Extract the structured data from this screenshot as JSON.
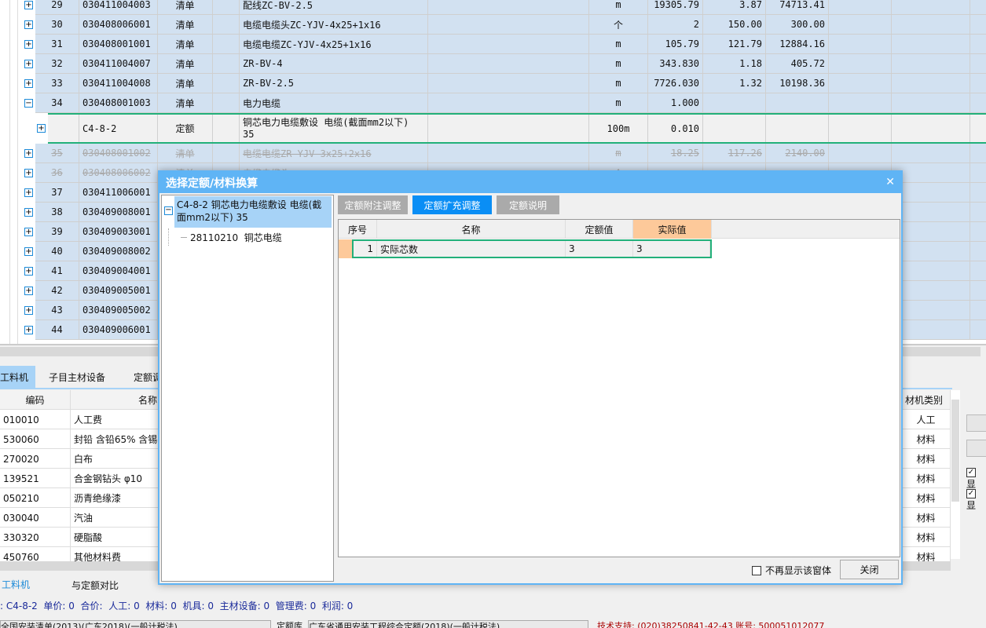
{
  "grid": {
    "rows": [
      {
        "seq": "29",
        "code": "030411004003",
        "type": "清单",
        "name": "配线ZC-BV-2.5",
        "unit": "m",
        "qty": "19305.79",
        "price": "3.87",
        "total": "74713.41",
        "exp": "+"
      },
      {
        "seq": "30",
        "code": "030408006001",
        "type": "清单",
        "name": "电缆电缆头ZC-YJV-4x25+1x16",
        "unit": "个",
        "qty": "2",
        "price": "150.00",
        "total": "300.00",
        "exp": "+"
      },
      {
        "seq": "31",
        "code": "030408001001",
        "type": "清单",
        "name": "电缆电缆ZC-YJV-4x25+1x16",
        "unit": "m",
        "qty": "105.79",
        "price": "121.79",
        "total": "12884.16",
        "exp": "+"
      },
      {
        "seq": "32",
        "code": "030411004007",
        "type": "清单",
        "name": "ZR-BV-4",
        "unit": "m",
        "qty": "343.830",
        "price": "1.18",
        "total": "405.72",
        "exp": "+"
      },
      {
        "seq": "33",
        "code": "030411004008",
        "type": "清单",
        "name": "ZR-BV-2.5",
        "unit": "m",
        "qty": "7726.030",
        "price": "1.32",
        "total": "10198.36",
        "exp": "+"
      },
      {
        "seq": "34",
        "code": "030408001003",
        "type": "清单",
        "name": "电力电缆",
        "unit": "m",
        "qty": "1.000",
        "price": "",
        "total": "",
        "exp": "−"
      },
      {
        "seq": "",
        "code": "C4-8-2",
        "type": "定额",
        "name": "铜芯电力电缆敷设 电缆(截面mm2以下) 35",
        "unit": "100m",
        "qty": "0.010",
        "price": "",
        "total": "",
        "exp": "+",
        "sel": true
      },
      {
        "seq": "35",
        "code": "030408001002",
        "type": "清单",
        "name": "电缆电缆ZR-YJV-3x25+2x16",
        "unit": "m",
        "qty": "18.25",
        "price": "117.26",
        "total": "2140.00",
        "exp": "+",
        "del": true
      },
      {
        "seq": "36",
        "code": "030408006002",
        "type": "清单",
        "name": "电缆电缆头",
        "unit": "个",
        "qty": "",
        "price": "",
        "total": "",
        "exp": "+",
        "del": true
      },
      {
        "seq": "37",
        "code": "030411006001",
        "type": "",
        "name": "",
        "unit": "",
        "qty": "",
        "price": "",
        "total": "",
        "exp": "+"
      },
      {
        "seq": "38",
        "code": "030409008001",
        "type": "",
        "name": "",
        "unit": "",
        "qty": "",
        "price": "",
        "total": "",
        "exp": "+"
      },
      {
        "seq": "39",
        "code": "030409003001",
        "type": "",
        "name": "",
        "unit": "",
        "qty": "",
        "price": "",
        "total": "",
        "exp": "+"
      },
      {
        "seq": "40",
        "code": "030409008002",
        "type": "",
        "name": "",
        "unit": "",
        "qty": "",
        "price": "",
        "total": "",
        "exp": "+"
      },
      {
        "seq": "41",
        "code": "030409004001",
        "type": "",
        "name": "",
        "unit": "",
        "qty": "",
        "price": "",
        "total": "",
        "exp": "+"
      },
      {
        "seq": "42",
        "code": "030409005001",
        "type": "",
        "name": "",
        "unit": "",
        "qty": "",
        "price": "",
        "total": "",
        "exp": "+"
      },
      {
        "seq": "43",
        "code": "030409005002",
        "type": "",
        "name": "",
        "unit": "",
        "qty": "",
        "price": "",
        "total": "",
        "exp": "+"
      },
      {
        "seq": "44",
        "code": "030409006001",
        "type": "",
        "name": "",
        "unit": "",
        "qty": "",
        "price": "",
        "total": "",
        "exp": "+"
      }
    ]
  },
  "bottom": {
    "tabs": [
      "工料机",
      "子目主材设备",
      "定额调"
    ],
    "headers": {
      "code": "编码",
      "name": "名称",
      "cat": "材机类别"
    },
    "rows": [
      {
        "code": "010010",
        "name": "人工费",
        "cat": "人工"
      },
      {
        "code": "530060",
        "name": "封铅 含铅65% 含锡",
        "cat": "材料"
      },
      {
        "code": "270020",
        "name": "白布",
        "cat": "材料"
      },
      {
        "code": "139521",
        "name": "合金钢钻头 φ10",
        "cat": "材料"
      },
      {
        "code": "050210",
        "name": "沥青绝缘漆",
        "cat": "材料"
      },
      {
        "code": "030040",
        "name": "汽油",
        "cat": "材料"
      },
      {
        "code": "330320",
        "name": "硬脂酸",
        "cat": "材料"
      },
      {
        "code": "450760",
        "name": "其他材料费",
        "cat": "材料"
      }
    ],
    "subtabs": [
      "工料机",
      "与定额对比"
    ],
    "status": ": C4-8-2  单价: 0  合价:  人工: 0  材料: 0  机具: 0  主材设备: 0  管理费: 0  利润: 0",
    "checkbox_labels": [
      "显",
      "显"
    ]
  },
  "footer": {
    "list_lib": "全国安装清单(2013)(广东2018)(一般计税法)",
    "quota_label": "定额库",
    "quota_lib": "广东省通用安装工程综合定额(2018)(一般计税法)",
    "support": "技术支持: (020)38250841-42-43 账号: 500051012077"
  },
  "dialog": {
    "title": "选择定额/材料换算",
    "close_icon": "✕",
    "tree_root": "C4-8-2  铜芯电力电缆敷设 电缆(截面mm2以下) 35",
    "tree_child": "28110210  铜芯电缆",
    "buttons": [
      "定额附注调整",
      "定额扩充调整",
      "定额说明"
    ],
    "table_headers": {
      "seq": "序号",
      "name": "名称",
      "quota": "定额值",
      "actual": "实际值"
    },
    "table_rows": [
      {
        "seq": "1",
        "name": "实际芯数",
        "quota": "3",
        "actual": "3"
      }
    ],
    "dont_show": "不再显示该窗体",
    "close": "关闭"
  },
  "colors": {
    "accent": "#5fb4f5",
    "active_button": "#0a8ef5",
    "selection": "#22b07a",
    "row": "#d2e1f1",
    "actual_header": "#fdc99a"
  }
}
